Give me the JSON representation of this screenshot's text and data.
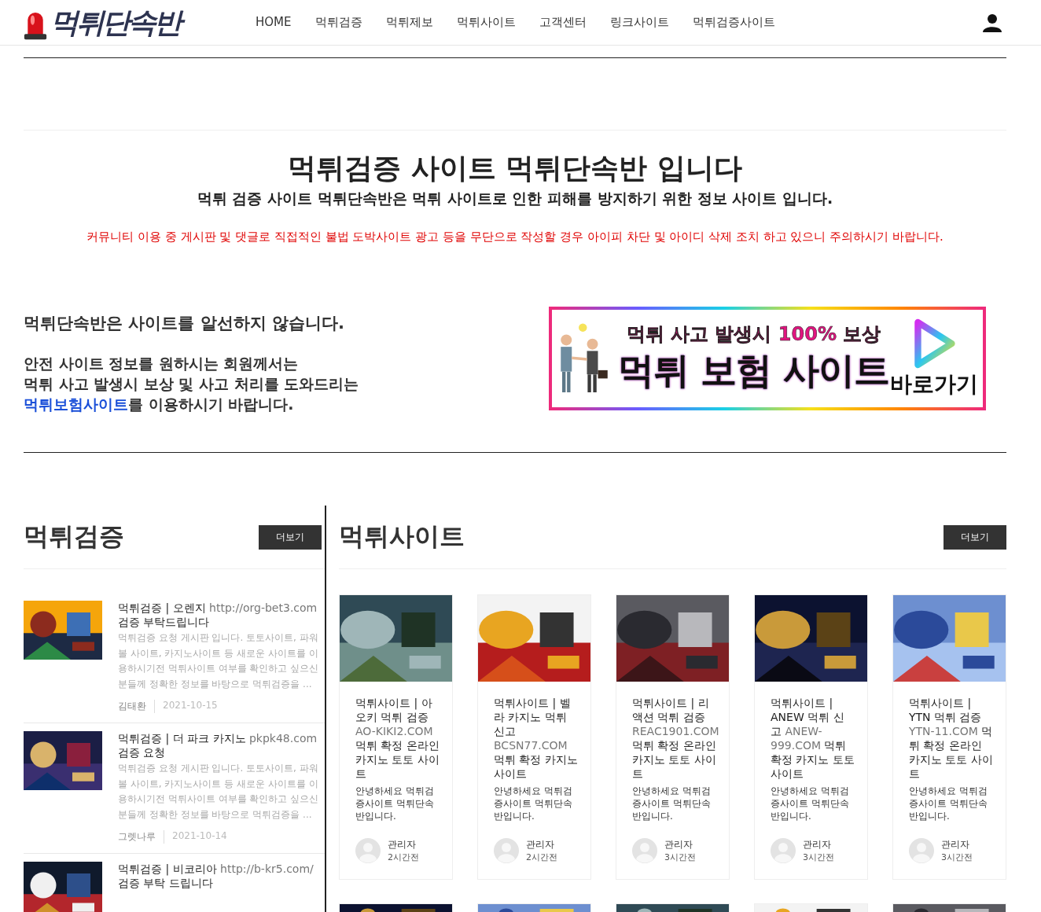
{
  "header": {
    "logo": "먹튀단속반",
    "nav": [
      {
        "label": "HOME"
      },
      {
        "label": "먹튀검증"
      },
      {
        "label": "먹튀제보"
      },
      {
        "label": "먹튀사이트"
      },
      {
        "label": "고객센터"
      },
      {
        "label": "링크사이트"
      },
      {
        "label": "먹튀검증사이트"
      }
    ]
  },
  "intro": {
    "title": "먹튀검증 사이트 먹튀단속반 입니다",
    "subtitle": "먹튀 검증 사이트 먹튀단속반은 먹튀 사이트로 인한 피해를 방지하기 위한 정보 사이트 입니다.",
    "notice": "커뮤니티 이용 중 게시판 및 댓글로 직접적인 불법 도박사이트 광고 등을 무단으로 작성할 경우 아이피 차단 및 아이디 삭제 조치 하고 있으니 주의하시기 바랍니다."
  },
  "info": {
    "statement": "먹튀단속반은 사이트를 알선하지 않습니다.",
    "lines": [
      "안전 사이트 정보를 원하시는 회원께서는",
      "먹튀 사고 발생시 보상 및 사고 처리를 도와드리는"
    ],
    "link": "먹튀보험사이트",
    "link_suffix": "를  이용하시기 바랍니다."
  },
  "banner": {
    "tagline": "먹튀 사고 발생시 100% 보상",
    "headline": "먹튀 보험 사이트",
    "action": "바로가기"
  },
  "verify": {
    "heading": "먹튀검증",
    "more": "더보기",
    "posts": [
      {
        "category": "먹튀검증 | ",
        "name": "오렌지 ",
        "url": "http://org-bet3.com",
        "suffix": " 검증 부탁드립니다",
        "excerpt": "먹튀검증 요청 게시판 입니다. 토토사이트, 파워볼 사이트, 카지노사이트 등 새로운 사이트를 이용하시기전 먹튀사이트 여부를 확인하고 싶으신 분들께 정확한 정보를 바탕으로 먹튀검증을 ...",
        "author": "김태환",
        "date": "2021-10-15"
      },
      {
        "category": "먹튀검증 | ",
        "name": "더 파크 카지노 ",
        "url": "pkpk48.com",
        "suffix": " 검증 요청",
        "excerpt": "먹튀검증 요청 게시판 입니다. 토토사이트, 파워볼 사이트, 카지노사이트 등 새로운 사이트를 이용하시기전 먹튀사이트 여부를 확인하고 싶으신 분들께 정확한 정보를 바탕으로 먹튀검증을 ...",
        "author": "그렛나루",
        "date": "2021-10-14"
      },
      {
        "category": "먹튀검증 | ",
        "name": "비코리아 ",
        "url": "http://b-kr5.com/",
        "suffix": " 검증 부탁 드립니다"
      }
    ]
  },
  "sites": {
    "heading": "먹튀사이트",
    "more": "더보기",
    "cards": [
      {
        "category": "먹튀사이트 | ",
        "name": "아오키 먹튀 검증 ",
        "url": "AO-KIKI2.COM",
        "suffix": " 먹튀 확정 온라인 카지노 토토 사이트",
        "excerpt": "안녕하세요 먹튀검증사이트 먹튀단속반입니다.",
        "author": "관리자",
        "time": "2시간전"
      },
      {
        "category": "먹튀사이트 | ",
        "name": "벨라 카지노 먹튀 신고 ",
        "url": "BCSN77.COM",
        "suffix": " 먹튀 확정 카지노 사이트",
        "excerpt": "안녕하세요 먹튀검증사이트 먹튀단속반입니다.",
        "author": "관리자",
        "time": "2시간전"
      },
      {
        "category": "먹튀사이트 | ",
        "name": "리액션 먹튀 검증 ",
        "url": "REAC1901.COM",
        "suffix": " 먹튀 확정 온라인 카지노 토토 사이트",
        "excerpt": "안녕하세요 먹튀검증사이트 먹튀단속반입니다.",
        "author": "관리자",
        "time": "3시간전"
      },
      {
        "category": "먹튀사이트 | ",
        "name": "ANEW 먹튀 신고 ",
        "url": "ANEW-999.COM",
        "suffix": " 먹튀 확정 카지노 토토 사이트",
        "excerpt": "안녕하세요 먹튀검증사이트 먹튀단속반입니다.",
        "author": "관리자",
        "time": "3시간전"
      },
      {
        "category": "먹튀사이트 | ",
        "name": "YTN 먹튀 검증 ",
        "url": "YTN-11.COM",
        "suffix": " 먹튀 확정 온라인 카지노 토토 사이트",
        "excerpt": "안녕하세요 먹튀검증사이트 먹튀단속반입니다.",
        "author": "관리자",
        "time": "3시간전"
      }
    ]
  }
}
